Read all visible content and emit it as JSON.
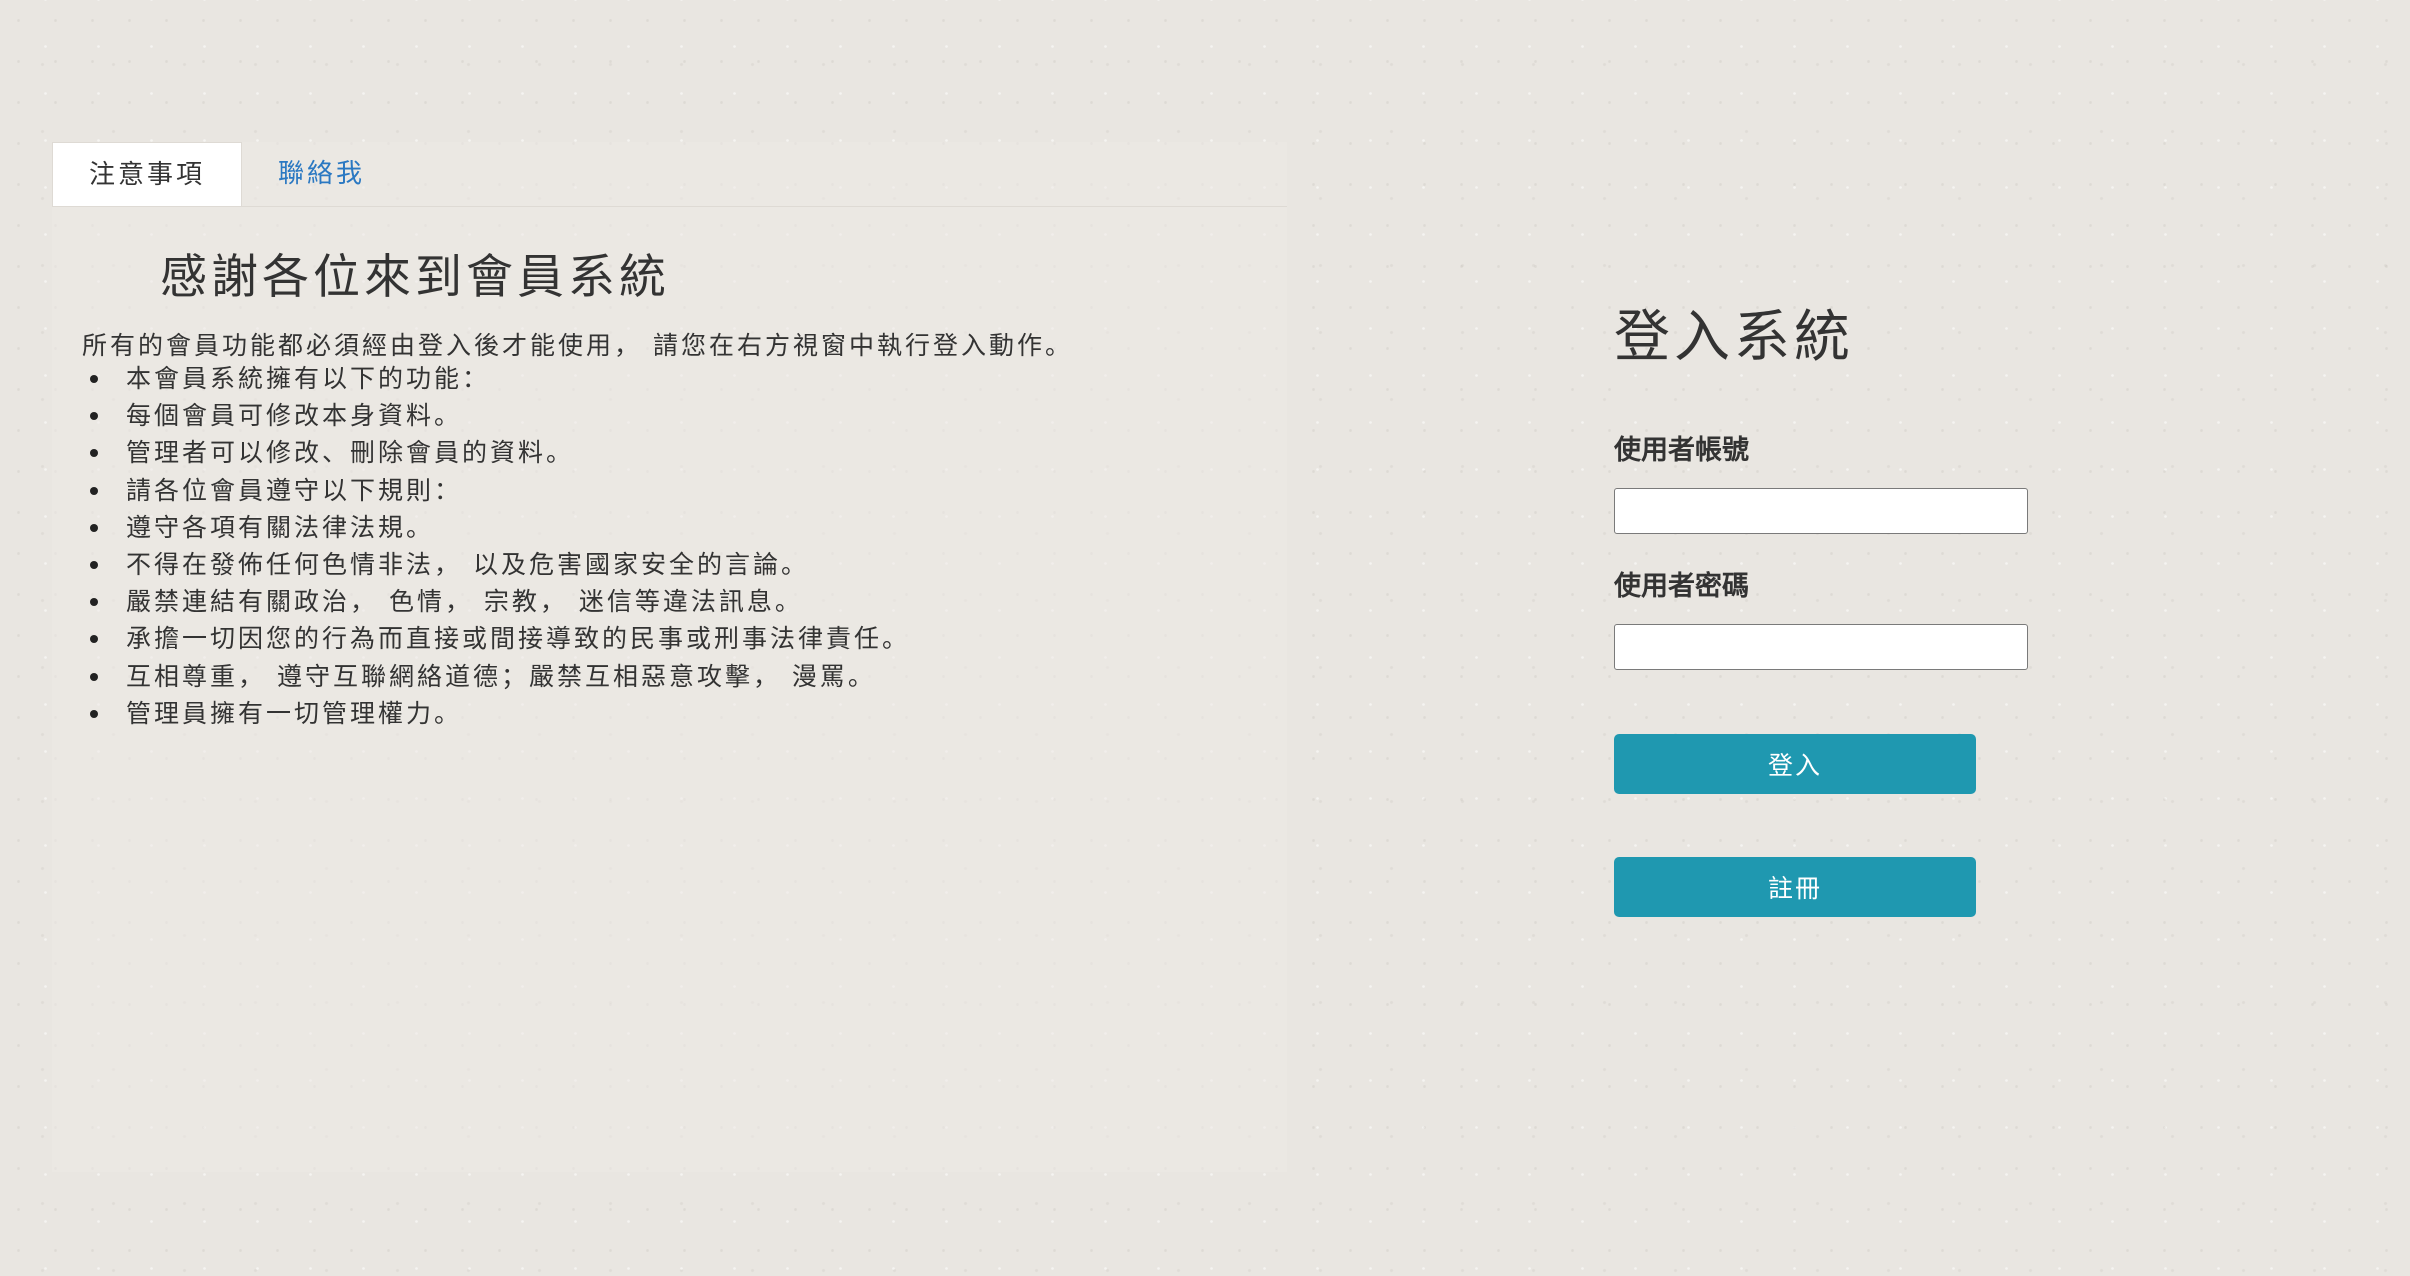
{
  "tabs": {
    "notice": "注意事項",
    "contact": "聯絡我"
  },
  "content": {
    "title": "感謝各位來到會員系統",
    "intro": "所有的會員功能都必須經由登入後才能使用， 請您在右方視窗中執行登入動作。",
    "items": [
      "本會員系統擁有以下的功能：",
      "每個會員可修改本身資料。",
      "管理者可以修改、刪除會員的資料。",
      "請各位會員遵守以下規則：",
      "遵守各項有關法律法規。",
      "不得在發佈任何色情非法， 以及危害國家安全的言論。",
      "嚴禁連結有關政治， 色情， 宗教， 迷信等違法訊息。",
      "承擔一切因您的行為而直接或間接導致的民事或刑事法律責任。",
      "互相尊重， 遵守互聯網絡道德；嚴禁互相惡意攻擊， 漫罵。",
      "管理員擁有一切管理權力。"
    ]
  },
  "login": {
    "title": "登入系統",
    "username_label": "使用者帳號",
    "username_value": "",
    "password_label": "使用者密碼",
    "password_value": "",
    "login_button": "登入",
    "register_button": "註冊"
  },
  "colors": {
    "accent": "#1f98b0",
    "link": "#2a78c2",
    "background": "#e9e6e1"
  }
}
